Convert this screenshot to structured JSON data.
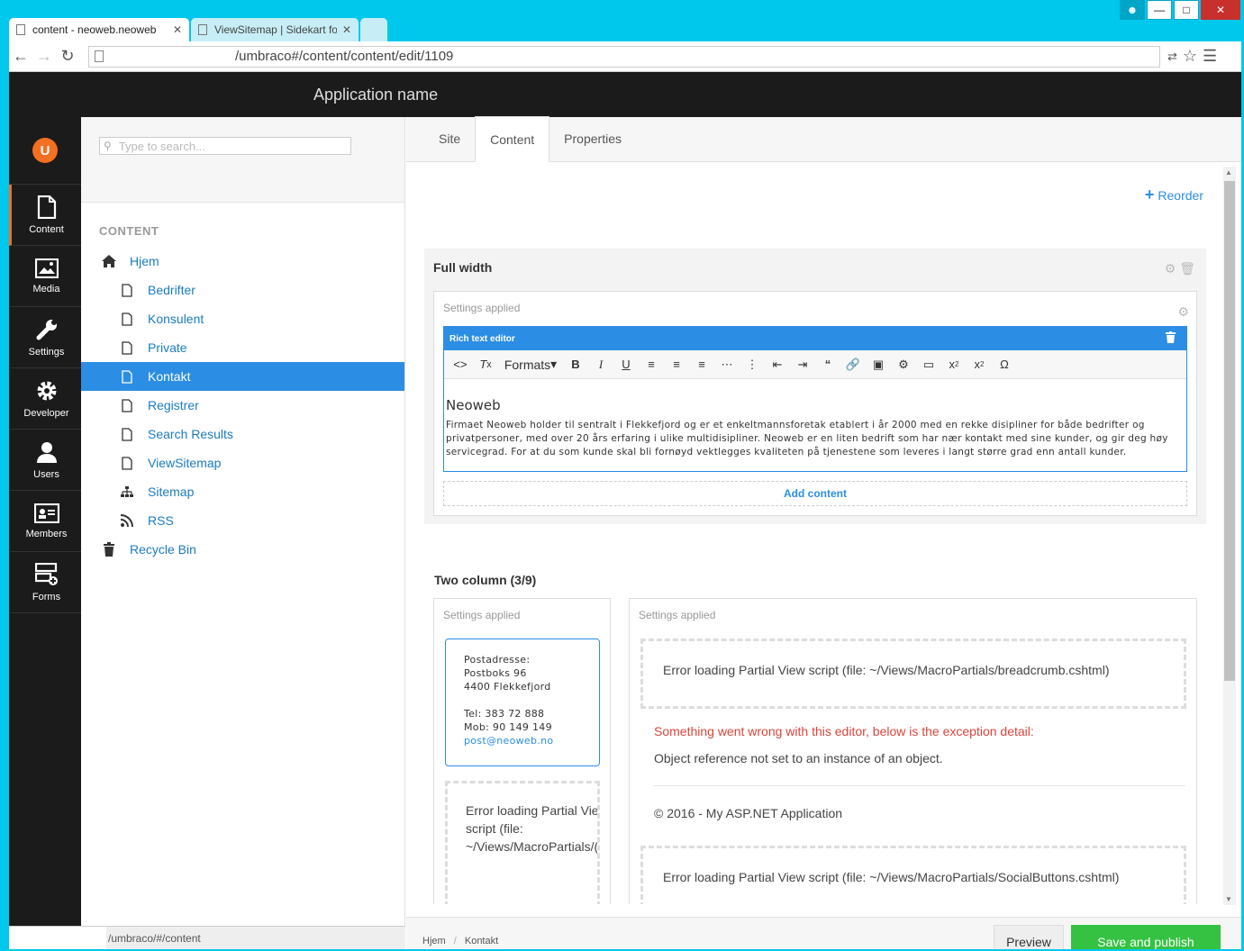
{
  "browser": {
    "tabs": [
      {
        "title": "content - neoweb.neoweb"
      },
      {
        "title": "ViewSitemap | Sidekart for"
      }
    ],
    "url": "/umbraco#/content/content/edit/1109",
    "status_url": "/umbraco/#/content"
  },
  "app": {
    "name": "Application name",
    "nav": [
      {
        "label": "Content",
        "icon": "document-icon"
      },
      {
        "label": "Media",
        "icon": "image-icon"
      },
      {
        "label": "Settings",
        "icon": "wrench-icon"
      },
      {
        "label": "Developer",
        "icon": "gear-icon"
      },
      {
        "label": "Users",
        "icon": "user-icon"
      },
      {
        "label": "Members",
        "icon": "id-card-icon"
      },
      {
        "label": "Forms",
        "icon": "forms-icon"
      }
    ]
  },
  "tree": {
    "search_placeholder": "Type to search...",
    "section": "CONTENT",
    "root": "Hjem",
    "children": [
      "Bedrifter",
      "Konsulent",
      "Private",
      "Kontakt",
      "Registrer",
      "Search Results",
      "ViewSitemap",
      "Sitemap",
      "RSS"
    ],
    "recycle": "Recycle Bin",
    "active": "Kontakt"
  },
  "editor": {
    "tabs": [
      "Site",
      "Content",
      "Properties"
    ],
    "active_tab": "Content",
    "reorder": "Reorder",
    "full_width": {
      "title": "Full width",
      "settings": "Settings applied",
      "rte_label": "Rich text editor",
      "formats": "Formats",
      "heading": "Neoweb",
      "body": "Firmaet Neoweb holder til sentralt i Flekkefjord og er et enkeltmannsforetak etablert i år 2000 med en rekke disipliner for både bedrifter og privatpersoner, med over 20 års erfaring i ulike multidisipliner. Neoweb er en liten bedrift som har nær kontakt med sine kunder, og gir deg høy servicegrad. For at du som kunde skal bli fornøyd vektlegges kvaliteten på tjenestene som leveres i langt større grad enn antall kunder.",
      "add_content": "Add content"
    },
    "two_column": {
      "title": "Two column (3/9)",
      "left_settings": "Settings applied",
      "right_settings": "Settings applied",
      "address": {
        "line1": "Postadresse:",
        "line2": "Postboks 96",
        "line3": "4400 Flekkefjord",
        "tel": "Tel: 383 72 888",
        "mob": "Mob: 90 149 149",
        "email": "post@neoweb.no"
      },
      "left_error": "Error loading Partial View script (file: ~/Views/MacroPartials/(",
      "error_breadcrumb": "Error loading Partial View script (file: ~/Views/MacroPartials/breadcrumb.cshtml)",
      "error_red": "Something went wrong with this editor, below is the exception detail:",
      "error_detail": "Object reference not set to an instance of an object.",
      "copyright": "© 2016 - My ASP.NET Application",
      "error_social": "Error loading Partial View script (file: ~/Views/MacroPartials/SocialButtons.cshtml)"
    }
  },
  "footer": {
    "crumb1": "Hjem",
    "crumb2": "Kontakt",
    "preview": "Preview",
    "save": "Save and publish"
  }
}
